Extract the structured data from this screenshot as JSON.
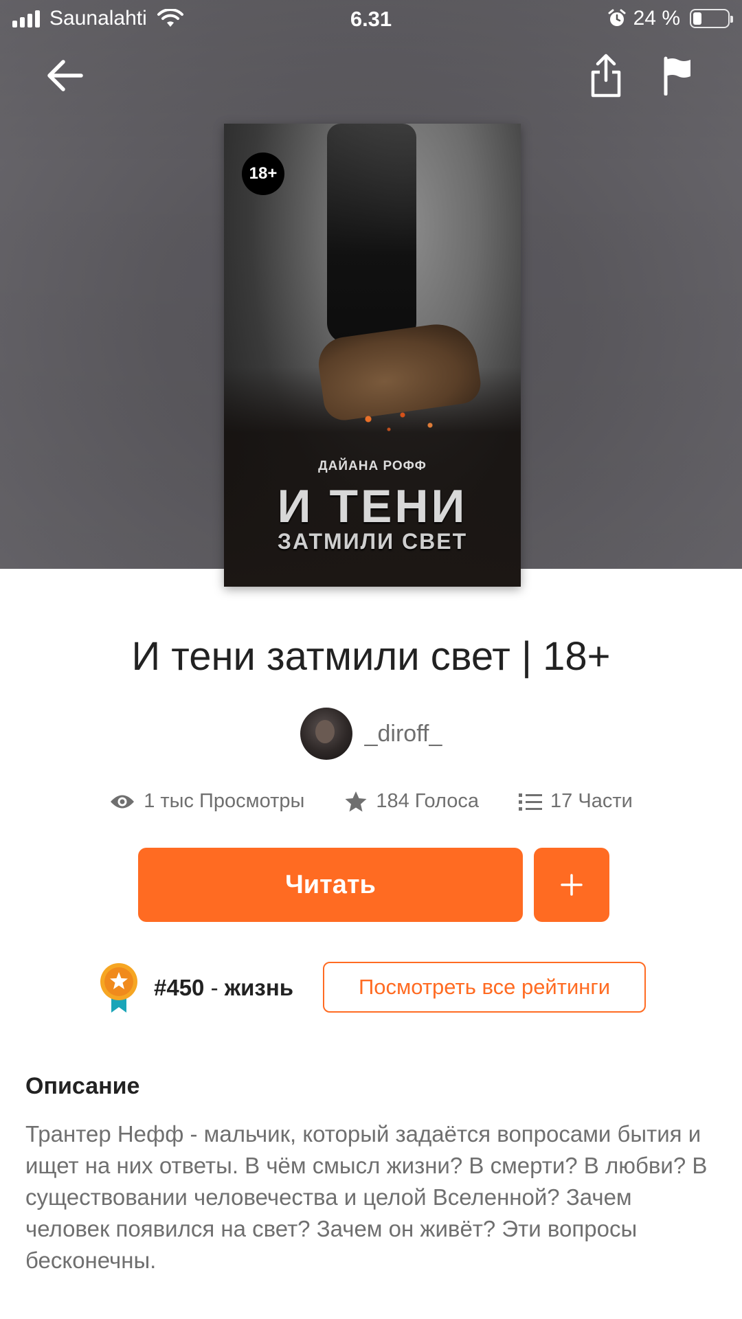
{
  "status_bar": {
    "carrier": "Saunalahti",
    "time": "6.31",
    "battery_percent": "24 %",
    "battery_level": 0.24
  },
  "nav": {
    "back_icon": "arrow-left-icon",
    "share_icon": "share-icon",
    "report_icon": "flag-icon"
  },
  "cover": {
    "badge": "18+",
    "author": "ДАЙАНА РОФФ",
    "title_line1": "И ТЕНИ",
    "title_line2": "ЗАТМИЛИ СВЕТ"
  },
  "story": {
    "title": "И тени затмили свет | 18+",
    "author": "_diroff_"
  },
  "stats": {
    "views": "1 тыс Просмотры",
    "votes": "184 Голоса",
    "parts": "17 Части"
  },
  "actions": {
    "read_label": "Читать",
    "add_label": "+"
  },
  "ranking": {
    "rank": "#450",
    "separator": " - ",
    "tag": "жизнь",
    "all_ratings_label": "Посмотреть все рейтинги"
  },
  "description": {
    "heading": "Описание",
    "text": "Трантер Нефф - мальчик, который задаётся вопросами бытия и ищет на них ответы. В чём смысл жизни? В смерти? В любви? В существовании человечества и целой Вселенной? Зачем человек появился на свет? Зачем он живёт? Эти вопросы бесконечны."
  },
  "colors": {
    "accent": "#ff6b22",
    "text_primary": "#222222",
    "text_secondary": "#6f6f6f"
  }
}
